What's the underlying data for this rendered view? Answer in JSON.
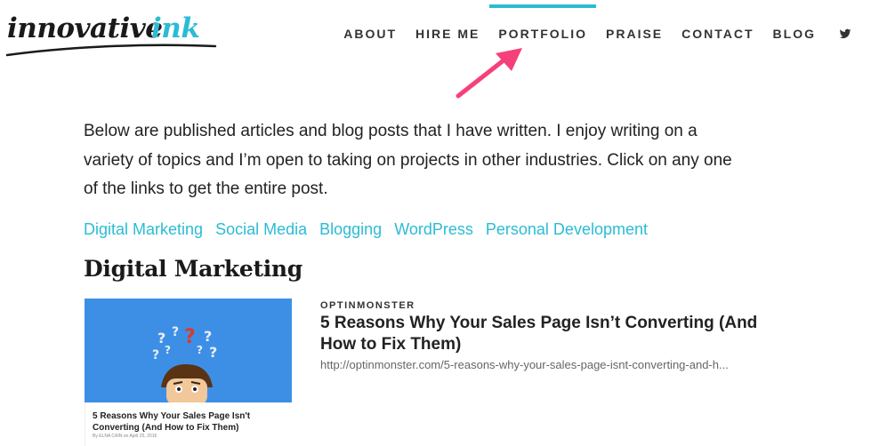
{
  "brand": {
    "logo_word_main": "innovative",
    "logo_word_accent": "ink",
    "accent_color": "#2bbcd4"
  },
  "nav": {
    "items": [
      "ABOUT",
      "HIRE ME",
      "PORTFOLIO",
      "PRAISE",
      "CONTACT",
      "BLOG"
    ],
    "active": "PORTFOLIO",
    "social_icon": "twitter-icon"
  },
  "annotation": {
    "arrow_color": "#f6407a"
  },
  "intro": "Below are published articles and blog posts that I have written. I enjoy writing on a variety of topics and I’m open to taking on projects in other industries. Click on any one of the links to get the entire post.",
  "categories": [
    "Digital Marketing",
    "Social Media",
    "Blogging",
    "WordPress",
    "Personal Development"
  ],
  "section": {
    "title": "Digital Marketing"
  },
  "article": {
    "source": "OPTINMONSTER",
    "title": "5 Reasons Why Your Sales Page Isn’t Converting (And How to Fix Them)",
    "url": "http://optinmonster.com/5-reasons-why-your-sales-page-isnt-converting-and-h...",
    "thumbnail": {
      "caption": "5 Reasons Why Your Sales Page Isn't Converting (And How to Fix Them)",
      "byline": "By ELNA CAIN on April 25, 2016"
    }
  }
}
